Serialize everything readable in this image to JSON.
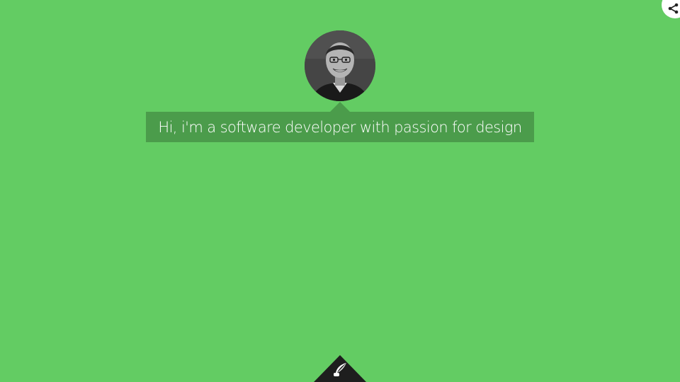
{
  "page": {
    "background_color": "#63cc63",
    "intro_box_color": "#4b9c4b",
    "intro_text_color": "#ffffff"
  },
  "header": {
    "share_icon": "share-icon"
  },
  "profile": {
    "avatar_alt": "Portrait photo",
    "intro_text": "Hi, i'm a software developer with passion for design"
  },
  "footer": {
    "blog_tab_color": "#1e1e1e",
    "blog_icon": "quill-icon"
  }
}
